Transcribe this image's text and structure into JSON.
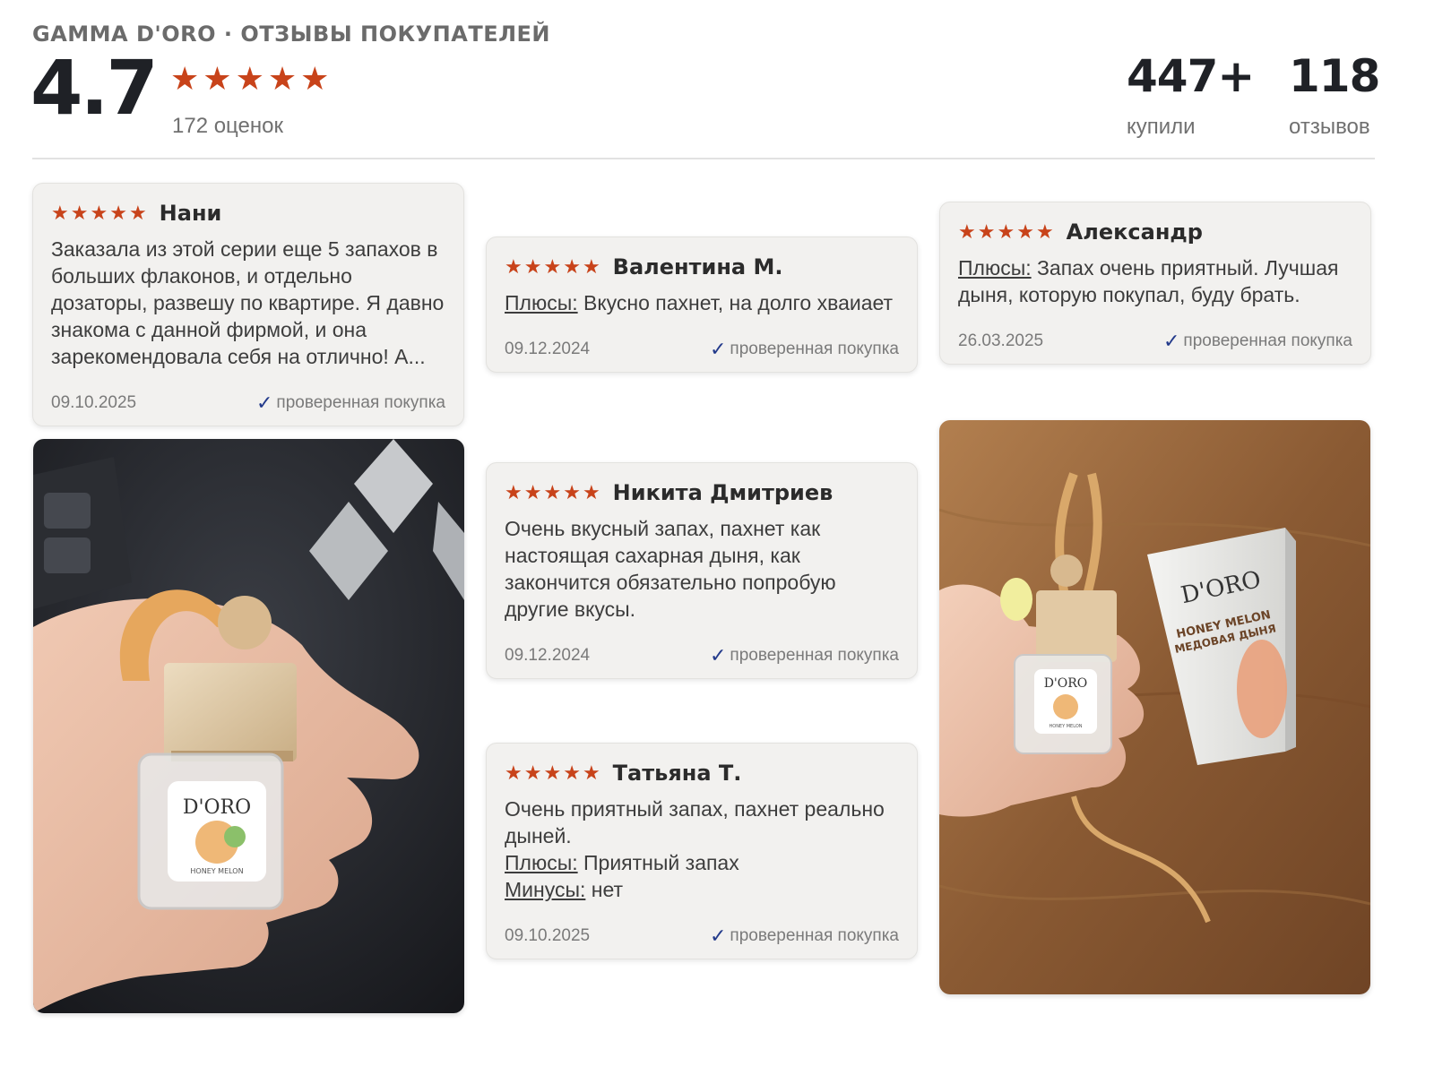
{
  "header": {
    "brand_title": "GAMMA D'ORO · ОТЗЫВЫ ПОКУПАТЕЛЕЙ",
    "average_rating": "4.7",
    "ratings_count": "172 оценок",
    "buyers_count": "447+",
    "buyers_label": "купили",
    "reviews_count": "118",
    "reviews_label": "отзывов"
  },
  "colors": {
    "star": "#c8431a",
    "check": "#233a8b"
  },
  "reviews": [
    {
      "author": "Нани",
      "rating": 5,
      "text": "Заказала из этой серии еще 5 запахов в больших флаконов, и отдельно дозаторы, развешу по квартире. Я давно знакома с данной фирмой, и она зарекомендовала себя на отлично! А...",
      "date": "09.10.2025",
      "verified": "проверенная покупка"
    },
    {
      "author": "Валентина М.",
      "rating": 5,
      "pros_label": "Плюсы:",
      "pros": " Вкусно пахнет, на долго хваиает",
      "date": "09.12.2024",
      "verified": "проверенная покупка"
    },
    {
      "author": "Александр",
      "rating": 5,
      "pros_label": "Плюсы:",
      "pros": " Запах очень приятный. Лучшая дыня, которую покупал, буду брать.",
      "date": "26.03.2025",
      "verified": "проверенная покупка"
    },
    {
      "author": "Никита Дмитриев",
      "rating": 5,
      "text": "Очень вкусный запах, пахнет как настоящая сахарная дыня, как закончится обязательно попробую другие вкусы.",
      "date": "09.12.2024",
      "verified": "проверенная покупка"
    },
    {
      "author": "Татьяна Т.",
      "rating": 5,
      "text": "Очень приятный запах, пахнет реально дыней.",
      "pros_label": "Плюсы:",
      "pros": " Приятный запах",
      "cons_label": "Минусы:",
      "cons": " нет",
      "date": "09.10.2025",
      "verified": "проверенная покупка"
    }
  ],
  "photos": {
    "left": {
      "bottle_brand": "D'ORO",
      "bottle_flavor": "HONEY MELON"
    },
    "right": {
      "bottle_brand": "D'ORO",
      "bottle_flavor": "HONEY MELON",
      "box_brand": "D'ORO",
      "box_line1": "HONEY MELON",
      "box_line2": "МЕДОВАЯ ДЫНЯ"
    }
  }
}
